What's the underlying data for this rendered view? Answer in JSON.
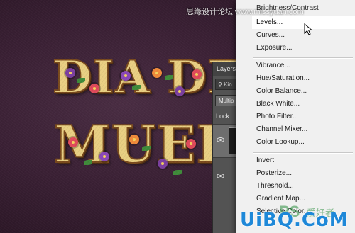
{
  "canvas": {
    "line1": "DIA DE",
    "line2": "MUERT"
  },
  "layers_panel": {
    "tab_label": "Layers",
    "filter_label": "Kin",
    "blend_label": "Multip",
    "lock_label": "Lock:"
  },
  "menu": {
    "top_item": "Brightness/Contrast",
    "items": [
      "Levels...",
      "Curves...",
      "Exposure...",
      "Vibrance...",
      "Hue/Saturation...",
      "Color Balance...",
      "Black  White...",
      "Photo Filter...",
      "Channel Mixer...",
      "Color Lookup...",
      "Invert",
      "Posterize...",
      "Threshold...",
      "Gradient Map...",
      "Selective Color..."
    ],
    "hovered_item": "Levels..."
  },
  "watermark": {
    "top": "思缘设计论坛 www.missyuan.com",
    "bottom": "UiBQ.CoM",
    "ps": "PS",
    "cn": "爱好者"
  },
  "colors": {
    "canvas_bg": "#3a2034",
    "menu_bg": "#f0f0f0",
    "panel_bg": "#535353",
    "letter_fill": "#e9cf82"
  }
}
